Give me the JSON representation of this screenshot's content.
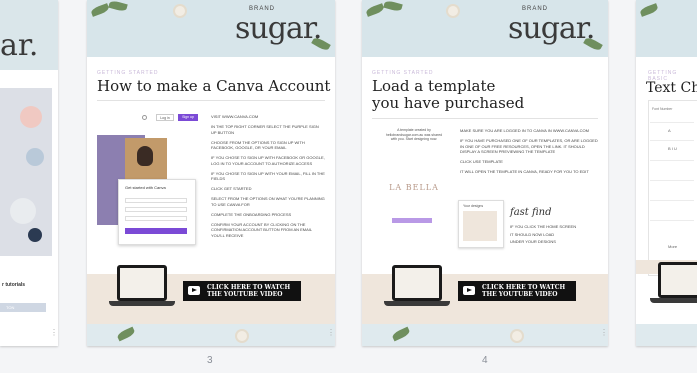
{
  "pages": [
    {
      "id": "left-partial",
      "brand": "ar.",
      "tutorial_text": "r tutorials",
      "button_label": "TON"
    },
    {
      "id": "page-3",
      "page_number": "3",
      "brand_small": "BRAND",
      "brand": "sugar.",
      "kicker": "GETTING STARTED",
      "title": "How to make a Canva Account",
      "ui_login": "Log in",
      "ui_signup": "Sign up",
      "modal_title": "Get started with Canva",
      "steps": [
        "VISIT WWW.CANVA.COM",
        "IN THE TOP RIGHT CORNER SELECT THE PURPLE SIGN UP BUTTON",
        "CHOOSE FROM THE OPTIONS TO SIGN UP WITH FACEBOOK, GOOGLE, OR YOUR EMAIL",
        "IF YOU CHOSE TO SIGN UP WITH FACEBOOK OR GOOGLE, LOG IN TO YOUR ACCOUNT TO AUTHORIZE ACCESS",
        "IF YOU CHOSE TO SIGN UP WITH YOUR EMAIL, FILL IN THE FIELDS",
        "CLICK GET STARTED",
        "SELECT FROM THE OPTIONS ON WHAT YOU'RE PLANNING TO USE CANVA FOR",
        "COMPLETE THE ONBOARDING PROCESS",
        "CONFIRM YOUR ACCOUNT BY CLICKING ON THE CONFIRMATION ACCOUNT BUTTON FROM AN EMAIL YOU'LL RECEIVE"
      ],
      "cta": "CLICK HERE TO WATCH THE YOUTUBE VIDEO"
    },
    {
      "id": "page-4",
      "page_number": "4",
      "brand_small": "BRAND",
      "brand": "sugar.",
      "kicker": "GETTING STARTED",
      "title_line1": "Load a template",
      "title_line2": "you have purchased",
      "template_caption": "A template created by hellobrandsugar.com.au was shared with you. Start designing now.",
      "template_name": "LA BELLA",
      "phone_label": "Your designs",
      "script_text": "fast find",
      "steps": [
        "MAKE SURE YOU ARE LOGGED IN TO CANVA IN WWW.CANVA.COM",
        "IF YOU HAVE PURCHASED ONE OF OUR TEMPLATES, OR ARE LOGGED IN ONE OF OUR FREE RESOURCES, OPEN THE LINK. IT SHOULD DISPLAY A SCREEN PREVIEWING THE TEMPLATE",
        "CLICK USE TEMPLATE",
        "IT WILL OPEN THE TEMPLATE IN CANVA, READY FOR YOU TO EDIT"
      ],
      "find_steps": [
        "IF YOU CLICK THE HOME SCREEN",
        "IT SHOULD NOW LOAD",
        "UNDER YOUR DESIGNS"
      ],
      "cta": "CLICK HERE TO WATCH THE YOUTUBE VIDEO"
    },
    {
      "id": "right-partial",
      "kicker": "GETTING BASIC",
      "title": "Text Ch",
      "panel_label": "Font Number",
      "cells": [
        "A",
        "B I U",
        "",
        "",
        "",
        "",
        "More"
      ]
    }
  ],
  "more_icon": "kebab-menu-icon",
  "colors": {
    "canvas_bg": "#f4f5f7",
    "header_blue": "#d7e5ea",
    "accent_purple": "#7b4ad6",
    "footer_beige": "#efe6dc"
  }
}
